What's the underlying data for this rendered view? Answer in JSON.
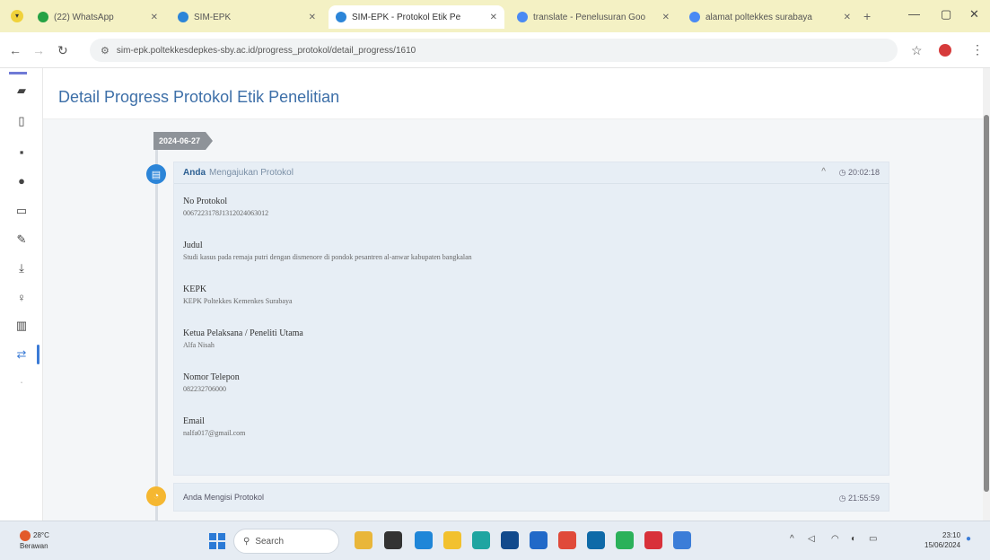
{
  "browser": {
    "tabs": [
      {
        "label": "(22) WhatsApp",
        "color": "#25a244",
        "active": false
      },
      {
        "label": "SIM-EPK",
        "color": "#2c85d8",
        "active": false
      },
      {
        "label": "SIM-EPK - Protokol Etik Pe",
        "color": "#2c85d8",
        "active": true
      },
      {
        "label": "translate - Penelusuran Goo",
        "color": "#4a8af4",
        "active": false
      },
      {
        "label": "alamat poltekkes surabaya",
        "color": "#4a8af4",
        "active": false
      }
    ],
    "url": "sim-epk.poltekkesdepkes-sby.ac.id/progress_protokol/detail_progress/1610"
  },
  "sidebar": {
    "icons": [
      {
        "name": "briefcase-icon",
        "glyph": "▰",
        "active": false
      },
      {
        "name": "document-icon",
        "glyph": "▯",
        "active": false
      },
      {
        "name": "book-icon",
        "glyph": "▪",
        "active": false
      },
      {
        "name": "circle-icon",
        "glyph": "●",
        "active": false
      },
      {
        "name": "monitor-icon",
        "glyph": "▭",
        "active": false
      },
      {
        "name": "edit-icon",
        "glyph": "✎",
        "active": false
      },
      {
        "name": "download-icon",
        "glyph": "⤓",
        "active": false
      },
      {
        "name": "bulb-icon",
        "glyph": "♀",
        "active": false
      },
      {
        "name": "grid-icon",
        "glyph": "▥",
        "active": false
      },
      {
        "name": "exchange-icon",
        "glyph": "⇄",
        "active": true
      },
      {
        "name": "dot-icon",
        "glyph": "·",
        "active": false
      }
    ]
  },
  "page": {
    "title": "Detail Progress Protokol Etik Penelitian"
  },
  "timeline": {
    "date": "2024-06-27",
    "entry1": {
      "actor": "Anda",
      "action": "Mengajukan Protokol",
      "collapse_glyph": "^",
      "time": "20:02:18",
      "fields": [
        {
          "label": "No Protokol",
          "value": "0067223178J1312024063012"
        },
        {
          "label": "Judul",
          "value": "Studi kasus pada remaja putri dengan dismenore di pondok pesantren al-anwar kabupaten bangkalan"
        },
        {
          "label": "KEPK",
          "value": "KEPK Poltekkes Kemenkes Surabaya"
        },
        {
          "label": "Ketua Pelaksana / Peneliti Utama",
          "value": "Alfa Nisah"
        },
        {
          "label": "Nomor Telepon",
          "value": "082232706000"
        },
        {
          "label": "Email",
          "value": "nalfa017@gmail.com"
        }
      ]
    },
    "entry2": {
      "text": "Anda Mengisi Protokol",
      "time": "21:55:59"
    }
  },
  "taskbar": {
    "weather_temp": "28°C",
    "weather_desc": "Berawan",
    "search_label": "Search",
    "clock_time": "23:10",
    "clock_date": "15/06/2024"
  }
}
